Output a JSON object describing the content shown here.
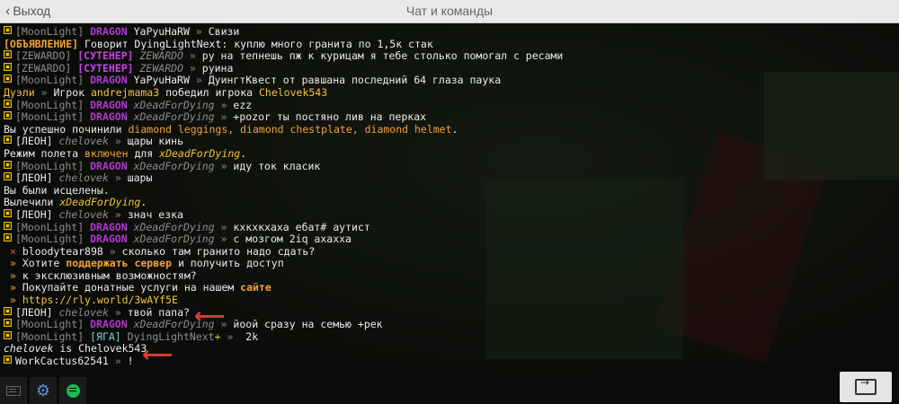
{
  "window": {
    "back_label": "Выход",
    "title": "Чат и команды"
  },
  "sep": "»",
  "lines": [
    {
      "tag": "[MoonLight]",
      "rank": "DRAGON",
      "user": "YaPyuHaRW",
      "text": "Свизи"
    },
    {
      "prefix": "[ОБЪЯВЛЕНИЕ]",
      "text": "Говорит DyingLightNext: куплю много гранита по 1,5к стак"
    },
    {
      "tag": "[ZEWARDO]",
      "rank": "[СУТЕНЕР]",
      "user": "ZEWARDO",
      "text": "ру на тепнешь пж к курицам я тебе столько помогал с ресами"
    },
    {
      "tag": "[ZEWARDO]",
      "rank": "[СУТЕНЕР]",
      "user": "ZEWARDO",
      "text": "руина"
    },
    {
      "tag": "[MoonLight]",
      "rank": "DRAGON",
      "user": "YaPyuHaRW",
      "text": "ДуингтКвест от равшана последний 64 глаза паука"
    },
    {
      "prefix": "Дуэли",
      "text1": "Игрок",
      "winner": "andrejmama3",
      "text2": "победил игрока",
      "loser": "Chelovek543"
    },
    {
      "tag": "[MoonLight]",
      "rank": "DRAGON",
      "user": "xDeadForDying",
      "text": "ezz"
    },
    {
      "tag": "[MoonLight]",
      "rank": "DRAGON",
      "user": "xDeadForDying",
      "text": "+pozor ты постяно лив на перках"
    },
    {
      "text": "Вы успешно починили",
      "items": "diamond leggings, diamond chestplate, diamond helmet",
      "end": "."
    },
    {
      "tag": "[ЛЕОН]",
      "user": "chelovek",
      "text": "щары кинь"
    },
    {
      "text1": "Режим полета",
      "state": "включен",
      "text2": "для",
      "user": "xDeadForDying",
      "end": "."
    },
    {
      "tag": "[MoonLight]",
      "rank": "DRAGON",
      "user": "xDeadForDying",
      "text": "иду ток класик"
    },
    {
      "tag": "[ЛЕОН]",
      "user": "chelovek",
      "text": "шары"
    },
    {
      "text": "Вы были исцелены."
    },
    {
      "text": "Вылечили",
      "user": "xDeadForDying",
      "end": "."
    },
    {
      "tag": "[ЛЕОН]",
      "user": "chelovek",
      "text": "знач езка"
    },
    {
      "tag": "[MoonLight]",
      "rank": "DRAGON",
      "user": "xDeadForDying",
      "text": "кхкхкхаха ебат# аутист"
    },
    {
      "tag": "[MoonLight]",
      "rank": "DRAGON",
      "user": "xDeadForDying",
      "text": "с мозгом 2iq ахахха"
    },
    {
      "mark": "×",
      "user": "bloodytear898",
      "text": "сколько там гранито надо сдать?"
    },
    {
      "text1": "Хотите",
      "hl": "поддержать сервер",
      "text2": "и получить доступ"
    },
    {
      "text": "к эксклюзивным возможностям?"
    },
    {
      "text1": "Покупайте донатные услуги на нашем",
      "hl": "сайте"
    },
    {
      "link": "https://rly.world/3wAYf5E"
    },
    {
      "tag": "[ЛЕОН]",
      "user": "chelovek",
      "text": "твой папа?"
    },
    {
      "tag": "[MoonLight]",
      "rank": "DRAGON",
      "user": "xDeadForDying",
      "text": "йоой сразу на семью +рек"
    },
    {
      "tag": "[MoonLight]",
      "rank": "[ЯГА]",
      "user": "DyingLightNext",
      "plus": "+",
      "text": "2k"
    },
    {
      "user": "chelovek",
      "mid": "is",
      "real": "Chelovek543"
    },
    {
      "user": "WorkCactus62541",
      "text": "!"
    }
  ],
  "colors": {
    "accent_yellow": "#f3c33a",
    "dragon_purple": "#b03ad0",
    "annotation_red": "#e63a2e"
  },
  "icons": {
    "keyboard": "keyboard-icon",
    "settings": "gear-icon",
    "spotify": "spotify-icon",
    "send": "send-icon",
    "annotation": "red-arrow-icon"
  }
}
